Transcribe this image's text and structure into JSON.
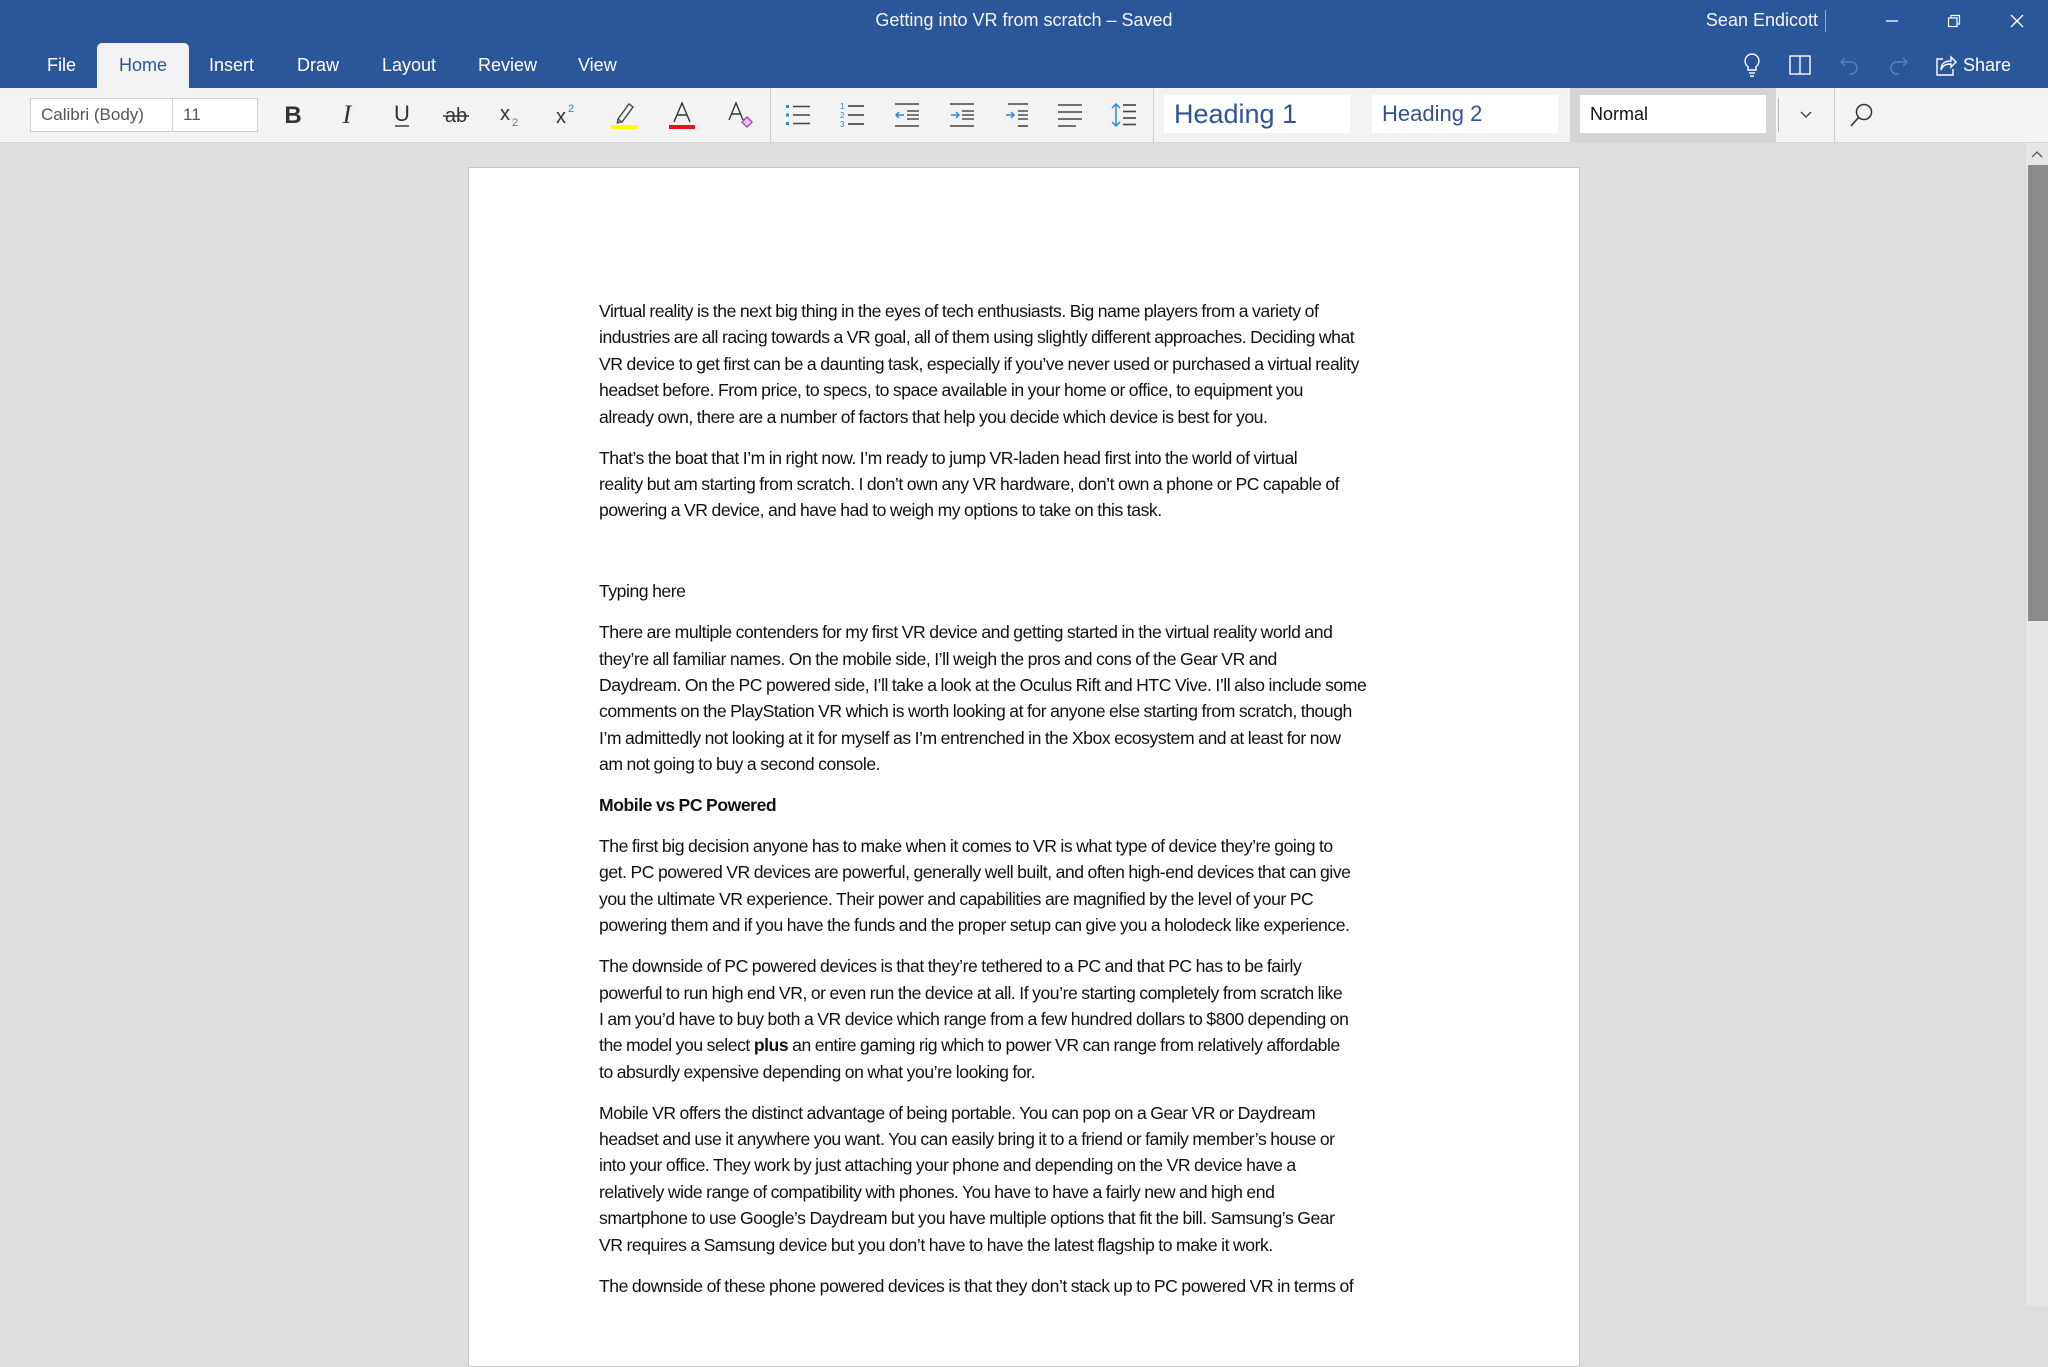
{
  "window": {
    "title": "Getting into VR from scratch – Saved",
    "user": "Sean Endicott"
  },
  "tabs": [
    {
      "label": "File"
    },
    {
      "label": "Home",
      "active": true
    },
    {
      "label": "Insert"
    },
    {
      "label": "Draw"
    },
    {
      "label": "Layout"
    },
    {
      "label": "Review"
    },
    {
      "label": "View"
    }
  ],
  "header_actions": {
    "share_label": "Share",
    "icons": [
      "lightbulb-icon",
      "reading-view-icon",
      "undo-icon",
      "redo-icon",
      "share-icon"
    ]
  },
  "ribbon": {
    "font_name": "Calibri (Body)",
    "font_size": "11",
    "styles": {
      "heading1": "Heading 1",
      "heading2": "Heading 2",
      "selected": "Normal"
    },
    "colors": {
      "highlight": "#ffff00",
      "font_color": "#e81123",
      "accent": "#2b579a",
      "icon_blue": "#2b88d8"
    }
  },
  "document": {
    "paragraphs": [
      {
        "type": "body",
        "lines": [
          "Virtual reality is the next big thing in the eyes of tech enthusiasts. Big name players from a variety of",
          "industries are all racing towards a VR goal, all of them using slightly different approaches. Deciding what",
          "VR device to get first can be a daunting task, especially if you’ve never used or purchased a virtual reality",
          "headset before. From price, to specs, to space available in your home or office, to equipment you",
          "already own, there are a number of factors that help you decide which device is best for you."
        ]
      },
      {
        "type": "body",
        "lines": [
          "That’s the boat that I’m in right now. I’m ready to jump VR-laden head first into the world of virtual",
          "reality but am starting from scratch. I don’t own any VR hardware, don’t own a phone or PC capable of",
          "powering a VR device, and have had to weigh my options to take on this task."
        ]
      },
      {
        "type": "body",
        "lines": [
          "Typing here"
        ]
      },
      {
        "type": "body",
        "lines": [
          "There are multiple contenders for my first VR device and getting started in the virtual reality world and",
          "they’re all familiar names. On the mobile side, I’ll weigh the pros and cons of the Gear VR and",
          "Daydream. On the PC powered side, I’ll take a look at the Oculus Rift and HTC Vive. I’ll also include some",
          "comments on the PlayStation VR which is worth looking at for anyone else starting from scratch, though",
          "I’m admittedly not looking at it for myself as I’m entrenched in the Xbox ecosystem and at least for now",
          "am not going to buy a second console."
        ]
      },
      {
        "type": "heading",
        "lines": [
          "Mobile vs PC Powered"
        ]
      },
      {
        "type": "body",
        "lines": [
          "The first big decision anyone has to make when it comes to VR is what type of device they’re going to",
          "get. PC powered VR devices are powerful, generally well built, and often high-end devices that can give",
          "you the ultimate VR experience. Their power and capabilities are magnified by the level of your PC",
          "powering them and if you have the funds and the proper setup can give you a holodeck like experience."
        ]
      },
      {
        "type": "body",
        "lines": [
          "The downside of PC powered devices is that they’re tethered to a PC and that PC has to be fairly",
          "powerful to run high end VR, or even run the device at all. If you’re starting completely from scratch like",
          "I am you’d have to buy both a VR device which range from a few hundred dollars to $800 depending on",
          {
            "before": "the model you select ",
            "bold": "plus",
            "after": " an entire gaming rig which to power VR can range from relatively affordable"
          },
          "to absurdly expensive depending on what you’re looking for."
        ]
      },
      {
        "type": "body",
        "lines": [
          "Mobile VR offers the distinct advantage of being portable. You can pop on a Gear VR or Daydream",
          "headset and use it anywhere you want. You can easily bring it to a friend or family member’s house or",
          "into your office. They work by just attaching your phone and depending on the VR device have a",
          "relatively wide range of compatibility with phones. You have to have a fairly new and high end",
          "smartphone to use Google’s Daydream but you have multiple options that fit the bill. Samsung’s Gear",
          "VR requires a Samsung device but you don’t have to have the latest flagship to make it work."
        ]
      },
      {
        "type": "body",
        "lines": [
          "The downside of these phone powered devices is that they don’t stack up to PC powered VR in terms of"
        ]
      }
    ]
  },
  "scrollbar": {
    "position_fraction": 0.0,
    "visible_fraction": 0.4
  }
}
